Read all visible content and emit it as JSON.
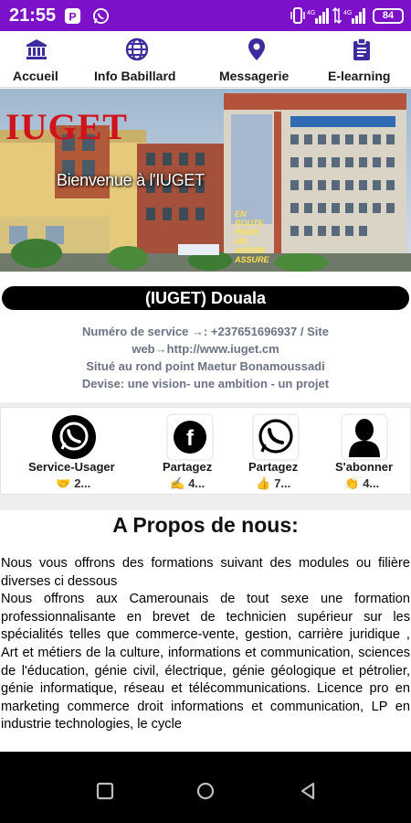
{
  "status_bar": {
    "time": "21:55",
    "battery": "84",
    "notification_icons": [
      "p-app-icon",
      "whatsapp-icon"
    ],
    "system_icons": [
      "vibrate-icon",
      "signal-icon",
      "signal-icon"
    ]
  },
  "nav": {
    "items": [
      {
        "label": "Accueil",
        "icon": "bank-icon"
      },
      {
        "label": "Info Babillard",
        "icon": "globe-icon"
      },
      {
        "label": "Messagerie",
        "icon": "location-pin-icon"
      },
      {
        "label": "E-learning",
        "icon": "clipboard-icon"
      }
    ],
    "accent_color": "#3d2a9e"
  },
  "hero": {
    "logo_text": "IUGET",
    "welcome_text": "Bienvenue à l'IUGET",
    "sign_text": "EN ROUTE POUR UN AVENIR ASSURE"
  },
  "title": "(IUGET) Douala",
  "info_lines": [
    "Numéro de service →: +237651696937 / Site",
    "web→http://www.iuget.cm",
    "Situé au rond point Maetur Bonamoussadi",
    "Devise: une vision- une ambition - un projet"
  ],
  "social": [
    {
      "label": "Service-Usager",
      "emoji": "🤝",
      "count": "2...",
      "icon": "whatsapp-icon"
    },
    {
      "label": "Partagez",
      "emoji": "✍",
      "count": "4...",
      "icon": "facebook-icon"
    },
    {
      "label": "Partagez",
      "emoji": "👍",
      "count": "7...",
      "icon": "whatsapp-icon"
    },
    {
      "label": "S'abonner",
      "emoji": "👏",
      "count": "4...",
      "icon": "user-icon"
    }
  ],
  "about": {
    "title": "A Propos de nous:",
    "para1": "Nous vous offrons des formations suivant des modules ou filière diverses ci dessous",
    "para2": "Nous offrons aux Camerounais de tout sexe une formation professionnalisante en brevet de technicien supérieur sur les spécialités telles que commerce-vente, gestion, carrière juridique , Art et métiers de la culture, informations et communication, sciences de l'éducation, génie civil, électrique, génie géologique et pétrolier, génie informatique, réseau et télécommunications. Licence pro en marketing commerce droit informations et communication, LP en industrie technologies, le cycle"
  },
  "colors": {
    "status_bar": "#7d10c9",
    "pill": "#000000",
    "info_text": "#6b7384",
    "logo_red": "#d0121a"
  }
}
